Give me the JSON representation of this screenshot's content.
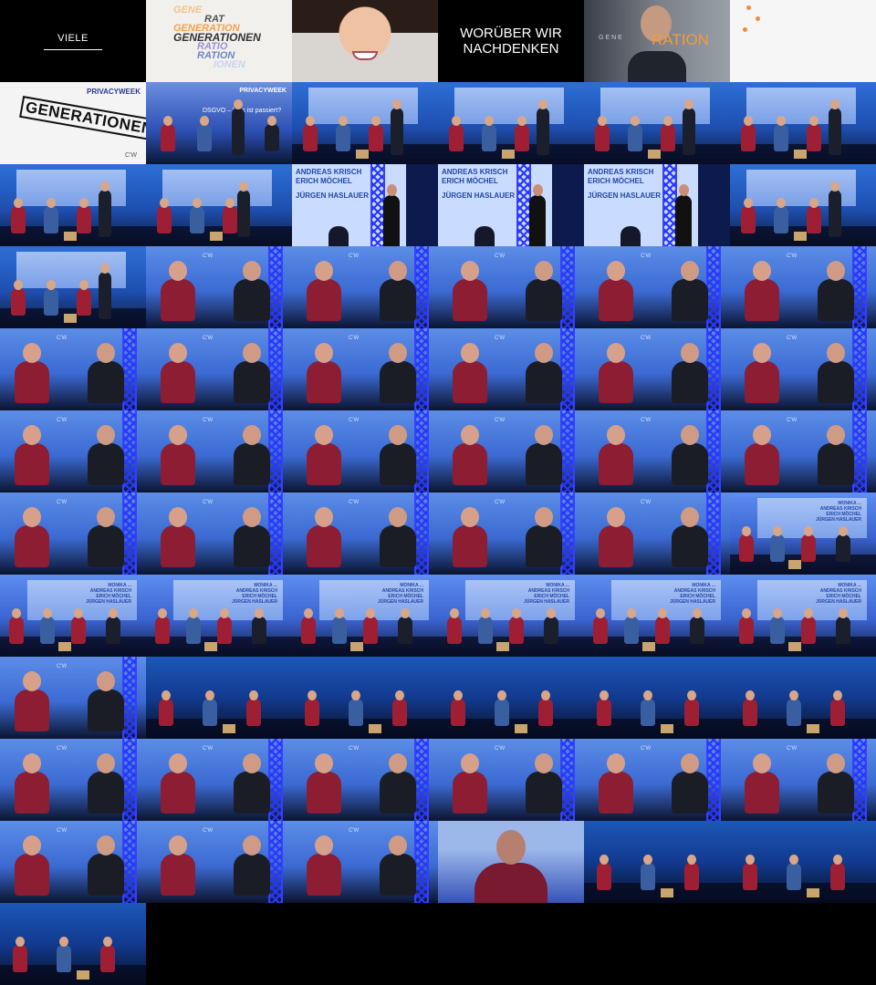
{
  "title_tiles": {
    "viele": "VIELE",
    "words": [
      "GENE",
      "RAT",
      "GENERATION",
      "GENERATIONEN",
      "RATIO",
      "RATION",
      "IONEN"
    ],
    "woruber": "WORÜBER WIR NACHDENKEN",
    "ration": "RATION",
    "generationen_stamp": "GENERATIONEN",
    "privacyweek": "PRIVACYWEEK",
    "cw_logo": "C'W",
    "talk_question": "DSGVO – Was ist passiert?",
    "speaker_names": "ANDREAS KRISCH\nERICH MÖCHEL",
    "speaker_name_2": "JÜRGEN HASLAUER",
    "screen_names": "MONIKA ...\nANDREAS KRISCH\nERICH MÖCHEL\nJÜRGEN HASLAUER"
  },
  "colors": {
    "accent_orange": "#f4a24a",
    "stage_blue": "#2d6fd6",
    "truss_blue": "#2a35ff",
    "shirt_red": "#9e1f34"
  },
  "grid": {
    "columns": 6,
    "rows": 11,
    "total_thumbnails": 66
  }
}
